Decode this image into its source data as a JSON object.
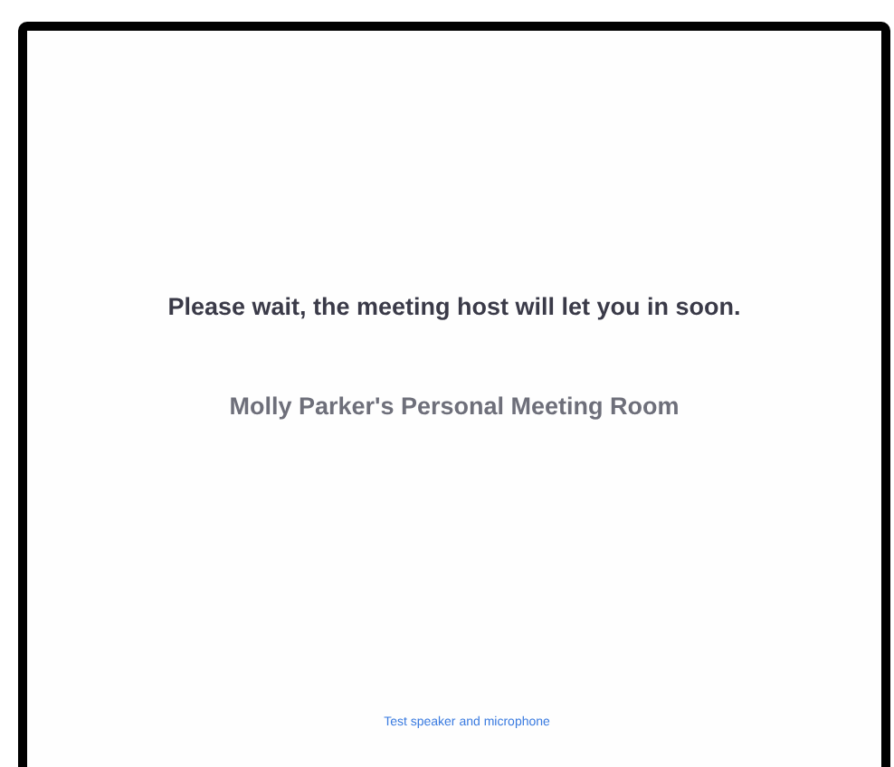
{
  "message": "Please wait, the meeting host will let you in soon.",
  "room_name": "Molly Parker's Personal Meeting Room",
  "test_link": "Test speaker and microphone"
}
